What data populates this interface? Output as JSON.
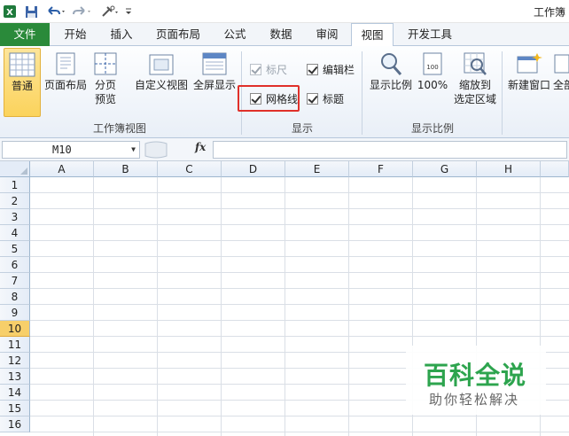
{
  "window": {
    "title": "工作簿"
  },
  "tabs": [
    {
      "label": "文件"
    },
    {
      "label": "开始"
    },
    {
      "label": "插入"
    },
    {
      "label": "页面布局"
    },
    {
      "label": "公式"
    },
    {
      "label": "数据"
    },
    {
      "label": "审阅"
    },
    {
      "label": "视图"
    },
    {
      "label": "开发工具"
    }
  ],
  "ribbon": {
    "workbook_views": {
      "group_label": "工作簿视图",
      "normal": "普通",
      "page_layout": "页面布局",
      "page_break_1": "分页",
      "page_break_2": "预览",
      "custom_views": "自定义视图",
      "full_screen": "全屏显示"
    },
    "show": {
      "group_label": "显示",
      "ruler": "标尺",
      "formula_bar": "编辑栏",
      "gridlines": "网格线",
      "headings": "标题"
    },
    "zoom": {
      "group_label": "显示比例",
      "zoom": "显示比例",
      "hundred": "100%",
      "zoom_selection_1": "缩放到",
      "zoom_selection_2": "选定区域"
    },
    "window": {
      "new_window": "新建窗口",
      "arrange_all": "全部"
    }
  },
  "formula_bar": {
    "name_box": "M10",
    "fx": "fx"
  },
  "grid": {
    "columns": [
      "A",
      "B",
      "C",
      "D",
      "E",
      "F",
      "G",
      "H"
    ],
    "rows": [
      "1",
      "2",
      "3",
      "4",
      "5",
      "6",
      "7",
      "8",
      "9",
      "10",
      "11",
      "12",
      "13",
      "14",
      "15",
      "16"
    ],
    "selected_row": "10"
  },
  "watermark": {
    "title": "百科全说",
    "subtitle": "助你轻松解决"
  },
  "colors": {
    "file_tab": "#2a8a3a",
    "highlight": "#e0302a",
    "selected_header": "#f7cf6a",
    "watermark": "#2da44e"
  },
  "icons": [
    "excel-icon",
    "save-icon",
    "undo-icon",
    "redo-icon",
    "customize-icon"
  ]
}
